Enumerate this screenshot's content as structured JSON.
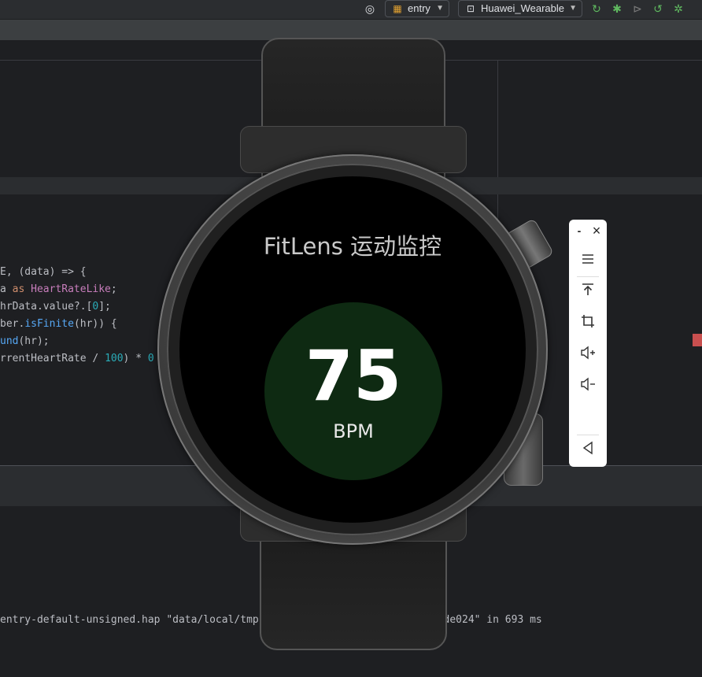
{
  "toolbar": {
    "module_label": "entry",
    "device_label": "Huawei_Wearable"
  },
  "code_lines": [
    {
      "parts": [
        {
          "t": "E, (data) => {",
          "c": ""
        }
      ]
    },
    {
      "parts": [
        {
          "t": "a ",
          "c": ""
        },
        {
          "t": "as ",
          "c": "kw"
        },
        {
          "t": "HeartRateLike",
          "c": "ty"
        },
        {
          "t": ";",
          "c": ""
        }
      ]
    },
    {
      "parts": [
        {
          "t": "hrData.value?.[",
          "c": ""
        },
        {
          "t": "0",
          "c": "nu"
        },
        {
          "t": "];",
          "c": ""
        }
      ]
    },
    {
      "parts": [
        {
          "t": "ber.",
          "c": ""
        },
        {
          "t": "isFinite",
          "c": "fn"
        },
        {
          "t": "(hr)) {",
          "c": ""
        }
      ]
    },
    {
      "parts": [
        {
          "t": "und",
          "c": "fn"
        },
        {
          "t": "(hr);",
          "c": ""
        }
      ]
    },
    {
      "parts": [
        {
          "t": "rrentHeartRate / ",
          "c": ""
        },
        {
          "t": "100",
          "c": "nu"
        },
        {
          "t": ") * ",
          "c": ""
        },
        {
          "t": "0",
          "c": "nu"
        }
      ]
    }
  ],
  "log_line": "entry-default-unsigned.hap \"data/local/tmp                              de024\" in 693 ms",
  "watch": {
    "title": "FitLens 运动监控",
    "heart_rate": "75",
    "unit": "BPM"
  },
  "emulator_bar": {
    "minimize": "-",
    "close": "×",
    "buttons": [
      "menu-icon",
      "pin-top-icon",
      "crop-icon",
      "volume-up-icon",
      "volume-down-icon",
      "back-icon"
    ]
  }
}
